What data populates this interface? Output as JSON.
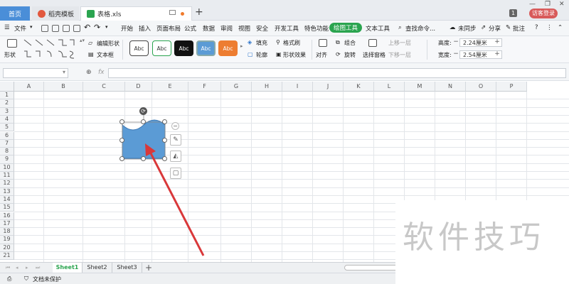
{
  "window": {
    "tabs": [
      {
        "label": "首页"
      },
      {
        "label": "稻壳模板"
      },
      {
        "label": "表格.xls"
      }
    ],
    "new_tab_symbol": "+",
    "badge_count": "1",
    "login_label": "访客登录",
    "controls": {
      "minimize": "—",
      "restore": "❐",
      "close": "✕"
    }
  },
  "menubar": {
    "file_label": "文件",
    "items": [
      "开始",
      "插入",
      "页面布局",
      "公式",
      "数据",
      "审阅",
      "视图",
      "安全",
      "开发工具",
      "特色功能",
      "绘图工具",
      "文本工具"
    ],
    "active_item": "绘图工具",
    "search_label": "查找命令...",
    "sync_label": "未同步",
    "share_label": "分享",
    "comment_label": "批注",
    "help_symbol": "?"
  },
  "ribbon": {
    "shape_label": "形状",
    "edit_shape_label": "编辑形状",
    "text_box_label": "文本框",
    "style_samples": [
      "Abc",
      "Abc",
      "Abc",
      "Abc",
      "Abc"
    ],
    "fill_label": "填充",
    "format_painter_label": "格式刷",
    "outline_label": "轮廓",
    "shape_effect_label": "形状效果",
    "align_label": "对齐",
    "group_label": "组合",
    "rotate_label": "旋转",
    "selection_pane_label": "选择窗格",
    "bring_forward_label": "上移一层",
    "send_backward_label": "下移一层",
    "height_label": "高度:",
    "height_value": "2.24厘米",
    "width_label": "宽度:",
    "width_value": "2.54厘米",
    "stepper_minus": "−",
    "stepper_plus": "+"
  },
  "formulabar": {
    "fx_label": "fx",
    "zoom_symbol": "⊕"
  },
  "sheet": {
    "columns": [
      "A",
      "B",
      "C",
      "D",
      "E",
      "F",
      "G",
      "H",
      "I",
      "J",
      "K",
      "L",
      "M",
      "N",
      "O",
      "P"
    ],
    "rows": [
      "1",
      "2",
      "3",
      "4",
      "5",
      "6",
      "7",
      "8",
      "9",
      "10",
      "11",
      "12",
      "13",
      "14",
      "15",
      "16",
      "17",
      "18",
      "19",
      "20",
      "21"
    ],
    "shape_fill_color": "#5b9bd5",
    "arrow_color": "#d9383a"
  },
  "sheettabs": {
    "tabs": [
      "Sheet1",
      "Sheet2",
      "Sheet3"
    ],
    "active": "Sheet1",
    "add_symbol": "+"
  },
  "statusbar": {
    "protect_label": "文档未保护"
  },
  "watermark": {
    "text": "软件技巧"
  }
}
